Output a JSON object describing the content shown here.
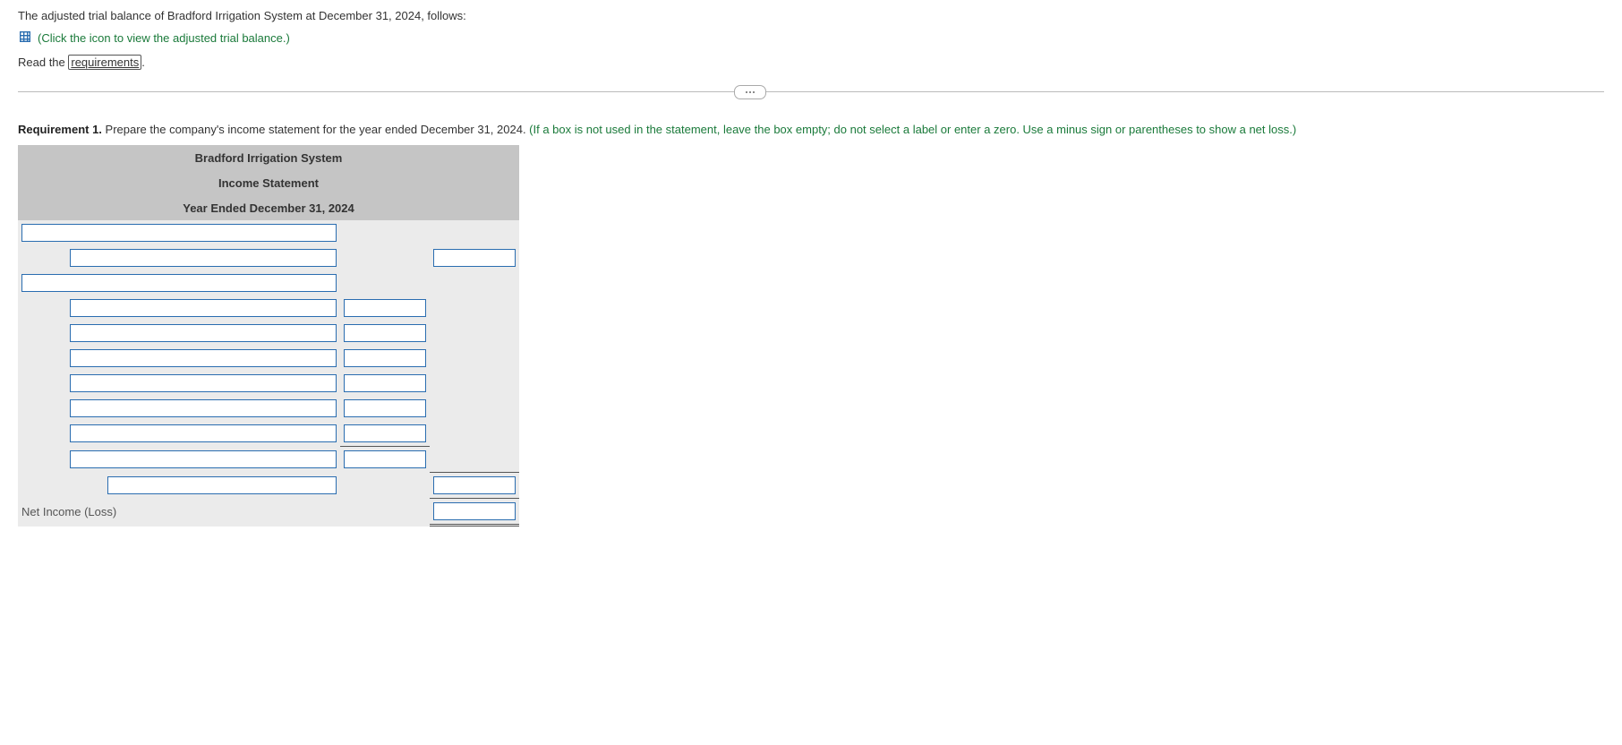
{
  "intro": "The adjusted trial balance of Bradford Irrigation System at December 31, 2024, follows:",
  "icon_link_text": "(Click the icon to view the adjusted trial balance.)",
  "read_prefix": "Read the ",
  "requirements_word": "requirements",
  "read_suffix": ".",
  "requirement": {
    "label": "Requirement 1.",
    "body": " Prepare the company's income statement for the year ended December 31, 2024. ",
    "hint": "(If a box is not used in the statement, leave the box empty; do not select a label or enter a zero. Use a minus sign or parentheses to show a net loss.)"
  },
  "statement": {
    "title1": "Bradford Irrigation System",
    "title2": "Income Statement",
    "title3": "Year Ended December 31, 2024",
    "net_income_label": "Net Income (Loss)"
  }
}
